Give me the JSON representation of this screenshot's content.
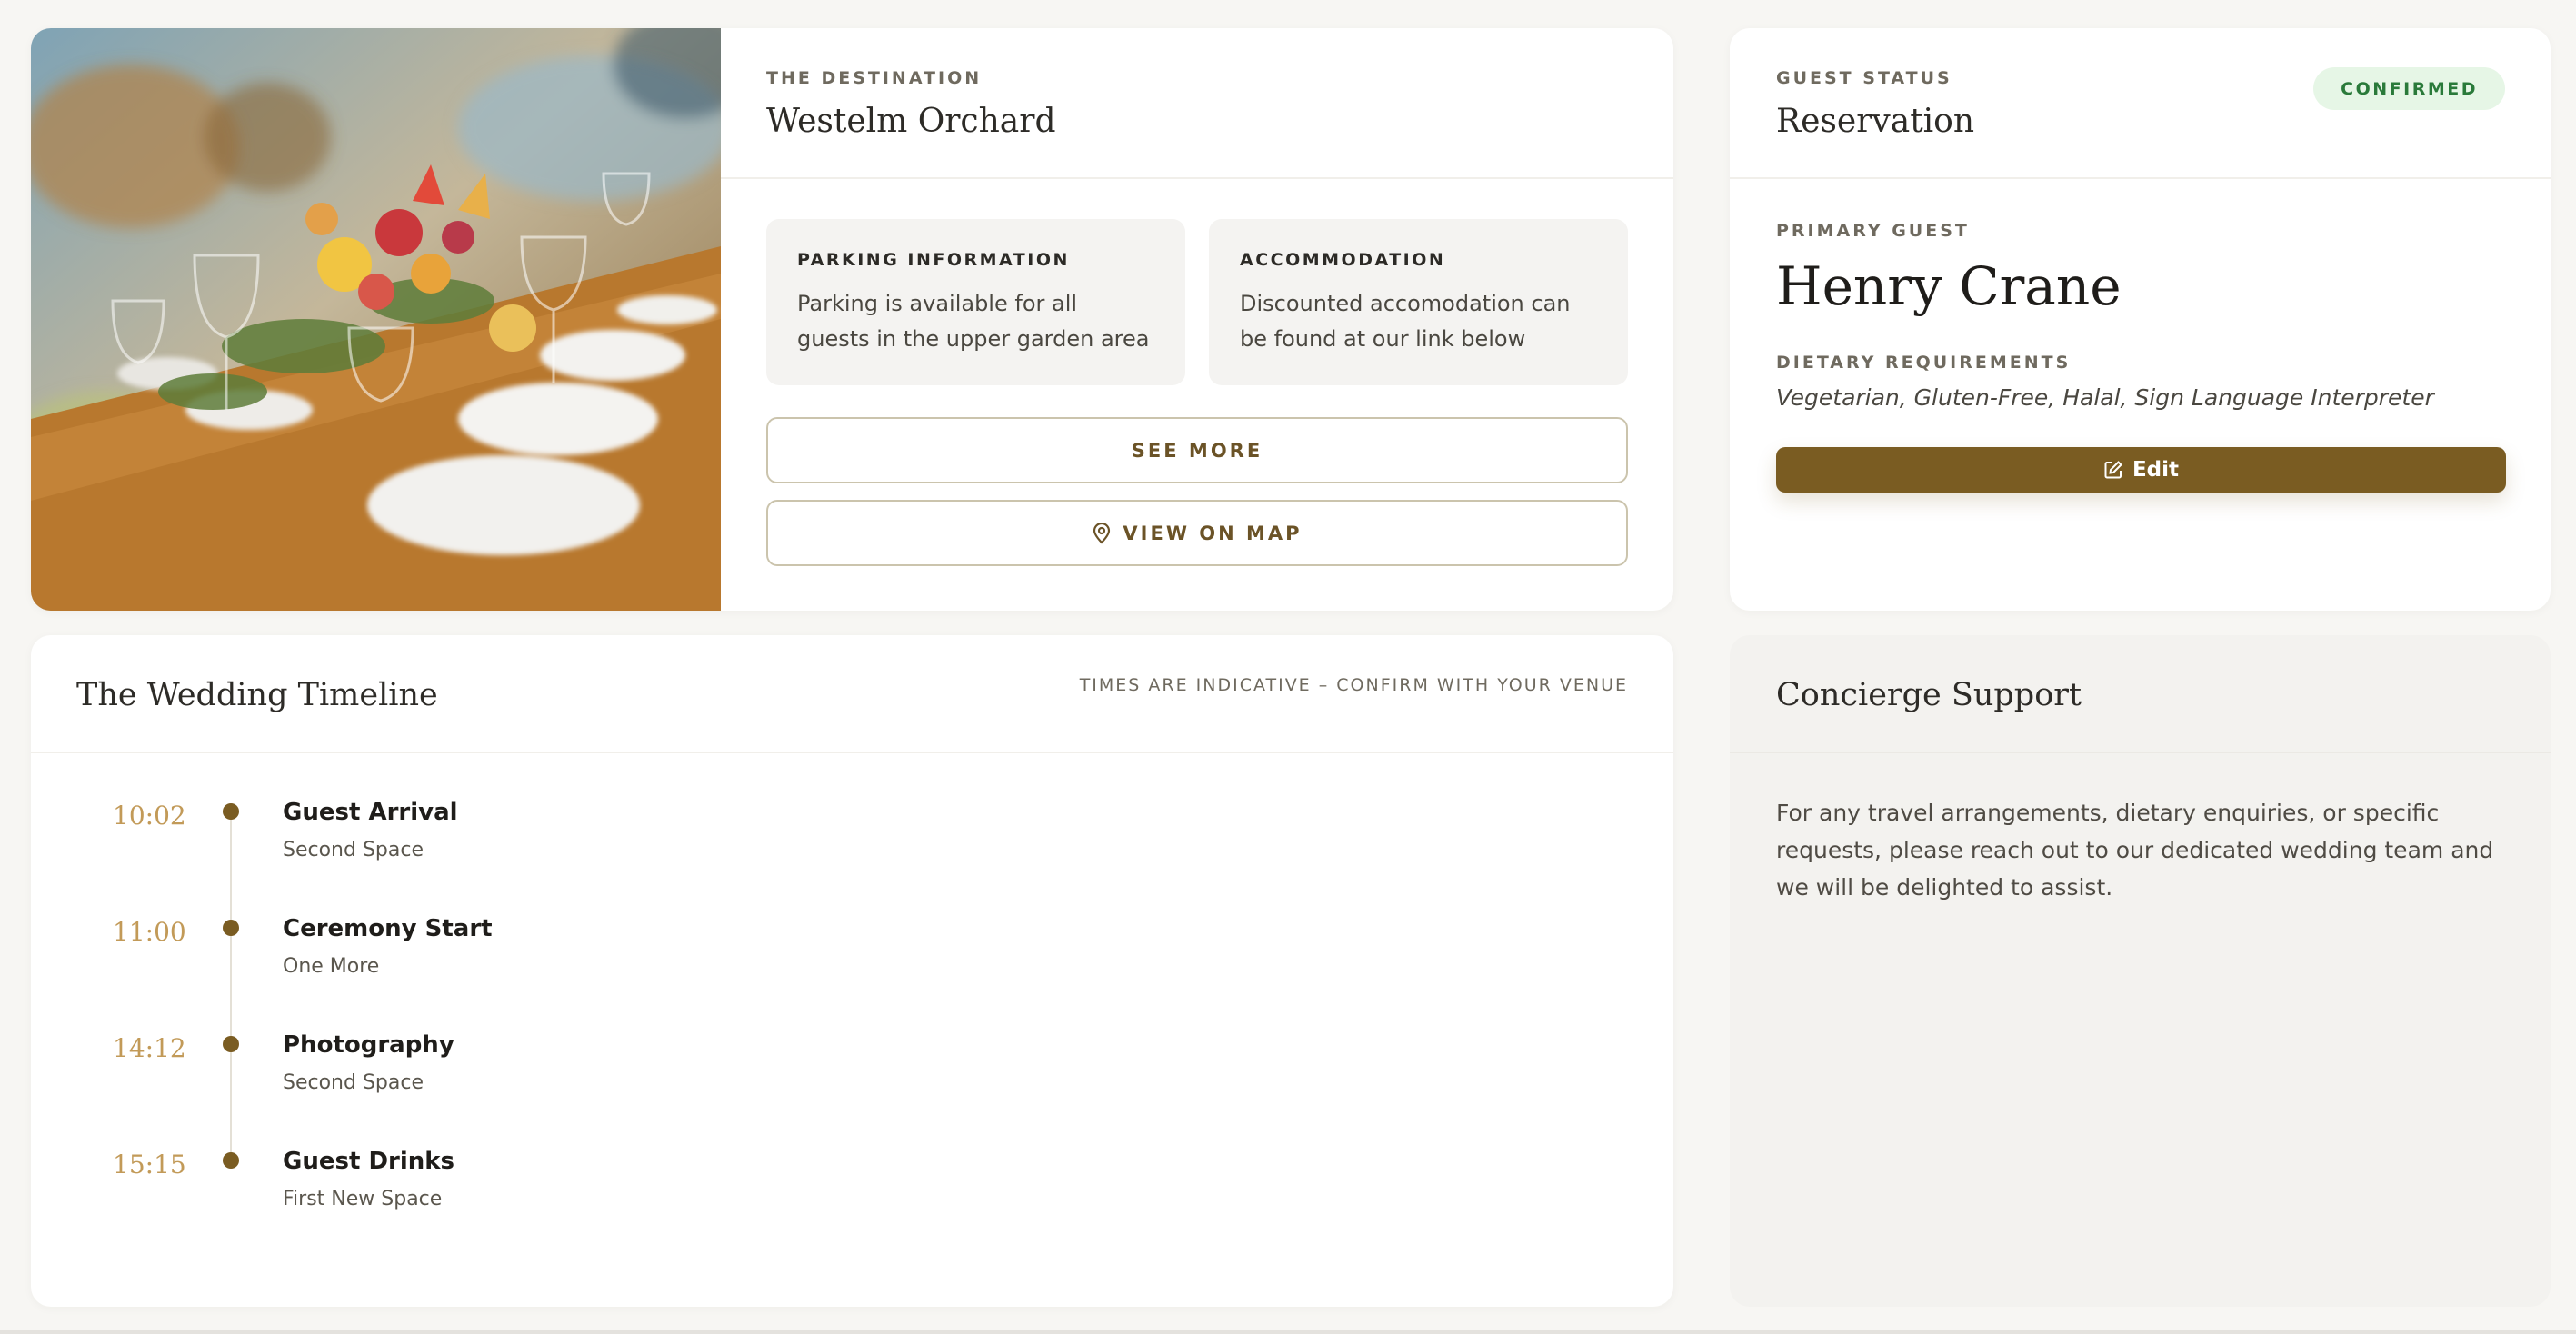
{
  "destination": {
    "eyebrow": "THE DESTINATION",
    "title": "Westelm Orchard",
    "parking": {
      "label": "PARKING INFORMATION",
      "text": "Parking is available for all guests in the upper garden area"
    },
    "accommodation": {
      "label": "ACCOMMODATION",
      "text": "Discounted accomodation can be found at our link below"
    },
    "see_more_label": "SEE MORE",
    "view_on_map_label": "VIEW ON MAP"
  },
  "reservation": {
    "eyebrow": "GUEST STATUS",
    "title": "Reservation",
    "status": "CONFIRMED",
    "primary_guest_label": "PRIMARY GUEST",
    "primary_guest": "Henry Crane",
    "dietary_label": "DIETARY REQUIREMENTS",
    "dietary": "Vegetarian, Gluten-Free, Halal, Sign Language Interpreter",
    "edit_label": "Edit"
  },
  "timeline": {
    "title": "The Wedding Timeline",
    "note": "TIMES ARE INDICATIVE – CONFIRM WITH YOUR VENUE",
    "items": [
      {
        "time": "10:02",
        "event": "Guest Arrival",
        "place": "Second Space"
      },
      {
        "time": "11:00",
        "event": "Ceremony Start",
        "place": "One More"
      },
      {
        "time": "14:12",
        "event": "Photography",
        "place": "Second Space"
      },
      {
        "time": "15:15",
        "event": "Guest Drinks",
        "place": "First New Space"
      }
    ]
  },
  "concierge": {
    "title": "Concierge Support",
    "text": "For any travel arrangements, dietary enquiries, or specific requests, please reach out to our dedicated wedding team and we will be delighted to assist."
  },
  "colors": {
    "accent": "#7a5c22",
    "time": "#c29a58",
    "badge_bg": "#e6f6e6",
    "badge_text": "#2a7a3a"
  },
  "icons": {
    "map": "map-pin-icon",
    "edit": "edit-icon"
  }
}
